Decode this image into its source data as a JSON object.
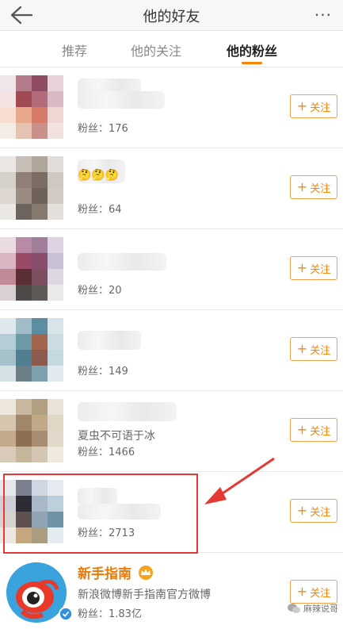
{
  "header": {
    "title": "他的好友",
    "back_icon": "back-arrow-icon",
    "more_label": "···"
  },
  "tabs": [
    {
      "label": "推荐",
      "active": false
    },
    {
      "label": "他的关注",
      "active": false
    },
    {
      "label": "他的粉丝",
      "active": true
    }
  ],
  "accent_color": "#ff8200",
  "users": [
    {
      "desc": "",
      "fans": "粉丝：176",
      "follow": "关注"
    },
    {
      "desc": "🤔🤔🤔",
      "fans": "粉丝：64",
      "follow": "关注"
    },
    {
      "desc": "",
      "fans": "粉丝：20",
      "follow": "关注"
    },
    {
      "desc": "",
      "fans": "粉丝：149",
      "follow": "关注"
    },
    {
      "desc": "夏虫不可语于冰",
      "fans": "粉丝：1466",
      "follow": "关注"
    },
    {
      "desc": "",
      "fans": "粉丝：2713",
      "follow": "关注"
    },
    {
      "name": "新手指南",
      "desc": "新浪微博新手指南官方微博",
      "fans": "粉丝：1.83亿",
      "follow": "关注"
    }
  ],
  "watermark": "麻辣说哥"
}
